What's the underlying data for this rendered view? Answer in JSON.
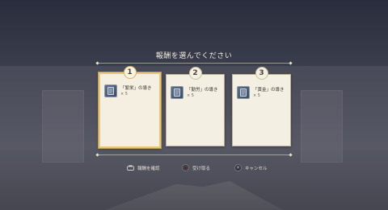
{
  "title": "報酬を選んでください",
  "rewards": [
    {
      "number": "1",
      "name": "「繁栄」の導き",
      "quantity": "× 5",
      "selected": true
    },
    {
      "number": "2",
      "name": "「勤労」の導き",
      "quantity": "× 5",
      "selected": false
    },
    {
      "number": "3",
      "name": "「黄金」の導き",
      "quantity": "× 5",
      "selected": false
    }
  ],
  "hints": {
    "confirm_label": "報酬を確認",
    "receive_label": "受け取る",
    "cancel_label": "キャンセル"
  },
  "colors": {
    "selected_border": "#e8c67a",
    "card_bg": "#f3efe3",
    "circle_button": "#e0624a",
    "cross_button": "#9fb7e6"
  }
}
